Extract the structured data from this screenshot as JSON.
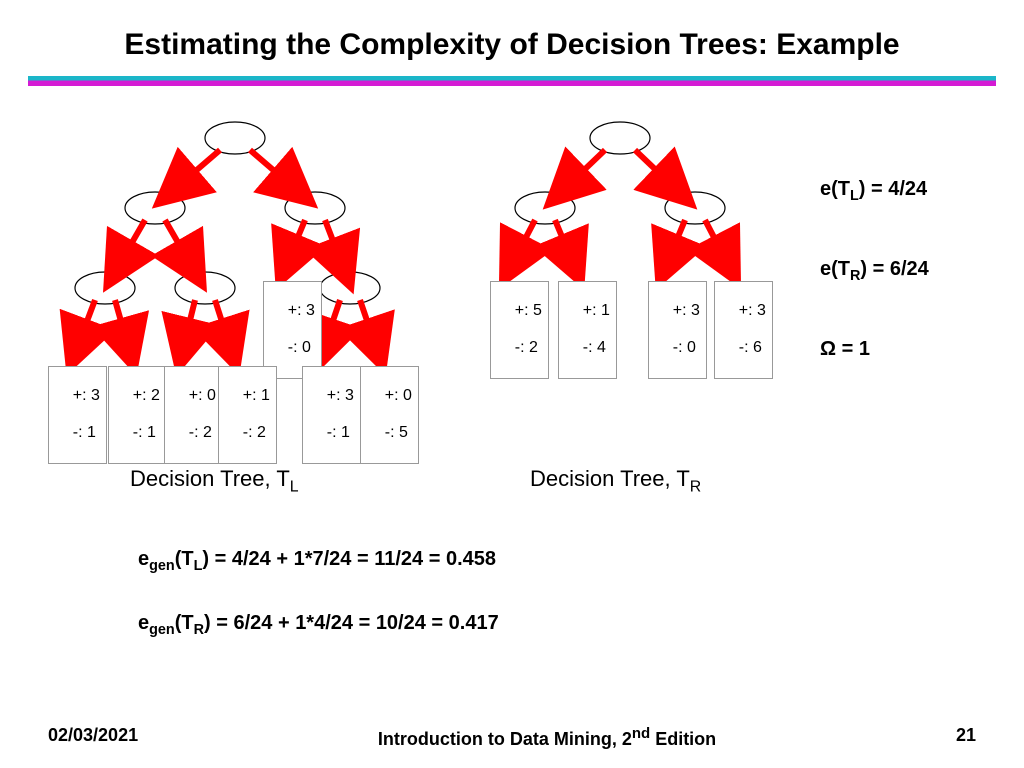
{
  "title": "Estimating the Complexity of Decision Trees: Example",
  "footer": {
    "date": "02/03/2021",
    "book": "Introduction to Data Mining, 2",
    "book_sup": "nd",
    "book_tail": " Edition",
    "page": "21"
  },
  "treeL": {
    "caption_pre": "Decision Tree, T",
    "caption_sub": "L",
    "leaves": [
      {
        "plus": "+: 3",
        "minus": "-: 1"
      },
      {
        "plus": "+: 2",
        "minus": "-: 1"
      },
      {
        "plus": "+: 0",
        "minus": "-: 2"
      },
      {
        "plus": "+: 1",
        "minus": "-: 2"
      },
      {
        "plus": "+: 3",
        "minus": "-: 0"
      },
      {
        "plus": "+: 3",
        "minus": "-: 1"
      },
      {
        "plus": "+: 0",
        "minus": "-: 5"
      }
    ]
  },
  "treeR": {
    "caption_pre": "Decision Tree, T",
    "caption_sub": "R",
    "leaves": [
      {
        "plus": "+: 5",
        "minus": "-: 2"
      },
      {
        "plus": "+: 1",
        "minus": "-: 4"
      },
      {
        "plus": "+: 3",
        "minus": "-: 0"
      },
      {
        "plus": "+: 3",
        "minus": "-: 6"
      }
    ]
  },
  "side": {
    "eTL_pre": "e(T",
    "eTL_sub": "L",
    "eTL_post": ") = 4/24",
    "eTR_pre": "e(T",
    "eTR_sub": "R",
    "eTR_post": ") = 6/24",
    "omega": "Ω = 1"
  },
  "equations": {
    "e1_pre": "e",
    "e1_sub": "gen",
    "e1_mid": "(T",
    "e1_sub2": "L",
    "e1_post": ") = 4/24 + 1*7/24 = 11/24 = 0.458",
    "e2_pre": "e",
    "e2_sub": "gen",
    "e2_mid": "(T",
    "e2_sub2": "R",
    "e2_post": ") = 6/24 + 1*4/24 = 10/24 = 0.417"
  },
  "chart_data": {
    "type": "tree",
    "trees": [
      {
        "name": "T_L",
        "leaves": [
          [
            3,
            1
          ],
          [
            2,
            1
          ],
          [
            0,
            2
          ],
          [
            1,
            2
          ],
          [
            3,
            0
          ],
          [
            3,
            1
          ],
          [
            0,
            5
          ]
        ],
        "leaf_count": 7,
        "e": "4/24"
      },
      {
        "name": "T_R",
        "leaves": [
          [
            5,
            2
          ],
          [
            1,
            4
          ],
          [
            3,
            0
          ],
          [
            3,
            6
          ]
        ],
        "leaf_count": 4,
        "e": "6/24"
      }
    ],
    "omega": 1,
    "e_gen": {
      "T_L": 0.458,
      "T_R": 0.417
    }
  }
}
